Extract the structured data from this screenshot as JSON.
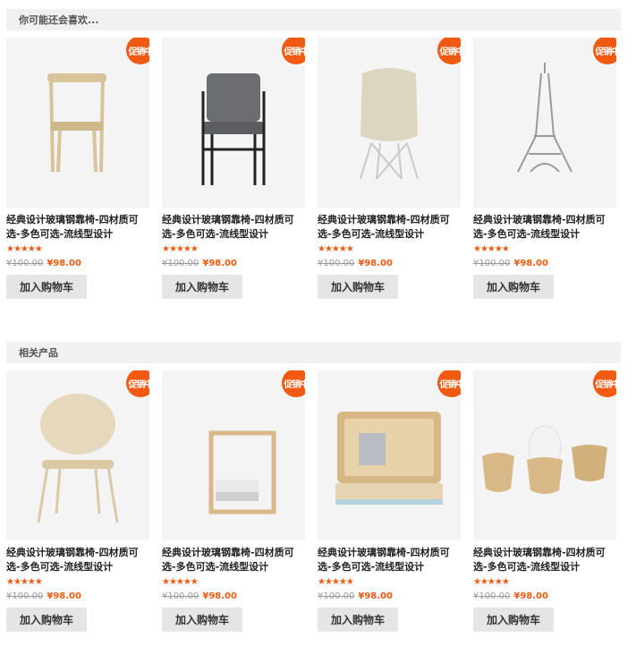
{
  "sections": [
    {
      "heading": "你可能还会喜欢...",
      "products": [
        {
          "badge": "促销中",
          "title": "经典设计玻璃钢靠椅-四材质可选-多色可选-流线型设计",
          "rating": "★★★★★",
          "old_price": "¥100.00",
          "new_price": "¥98.00",
          "cart_label": "加入购物车",
          "image": "wooden-chair-icon"
        },
        {
          "badge": "促销中",
          "title": "经典设计玻璃钢靠椅-四材质可选-多色可选-流线型设计",
          "rating": "★★★★★",
          "old_price": "¥100.00",
          "new_price": "¥98.00",
          "cart_label": "加入购物车",
          "image": "gray-armchair-icon"
        },
        {
          "badge": "促销中",
          "title": "经典设计玻璃钢靠椅-四材质可选-多色可选-流线型设计",
          "rating": "★★★★★",
          "old_price": "¥100.00",
          "new_price": "¥98.00",
          "cart_label": "加入购物车",
          "image": "eames-chair-icon"
        },
        {
          "badge": "促销中",
          "title": "经典设计玻璃钢靠椅-四材质可选-多色可选-流线型设计",
          "rating": "★★★★★",
          "old_price": "¥100.00",
          "new_price": "¥98.00",
          "cart_label": "加入购物车",
          "image": "eiffel-tower-icon"
        }
      ]
    },
    {
      "heading": "相关产品",
      "products": [
        {
          "badge": "促销中",
          "title": "经典设计玻璃钢靠椅-四材质可选-多色可选-流线型设计",
          "rating": "★★★★★",
          "old_price": "¥100.00",
          "new_price": "¥98.00",
          "cart_label": "加入购物车",
          "image": "round-back-chair-icon"
        },
        {
          "badge": "促销中",
          "title": "经典设计玻璃钢靠椅-四材质可选-多色可选-流线型设计",
          "rating": "★★★★★",
          "old_price": "¥100.00",
          "new_price": "¥98.00",
          "cart_label": "加入购物车",
          "image": "side-table-icon"
        },
        {
          "badge": "促销中",
          "title": "经典设计玻璃钢靠椅-四材质可选-多色可选-流线型设计",
          "rating": "★★★★★",
          "old_price": "¥100.00",
          "new_price": "¥98.00",
          "cart_label": "加入购物车",
          "image": "wall-desk-icon"
        },
        {
          "badge": "促销中",
          "title": "经典设计玻璃钢靠椅-四材质可选-多色可选-流线型设计",
          "rating": "★★★★★",
          "old_price": "¥100.00",
          "new_price": "¥98.00",
          "cart_label": "加入购物车",
          "image": "wooden-cups-icon"
        }
      ]
    }
  ],
  "colors": {
    "accent": "#f25a12",
    "header_bg": "#f1f1f1",
    "button_bg": "#e5e5e5"
  }
}
